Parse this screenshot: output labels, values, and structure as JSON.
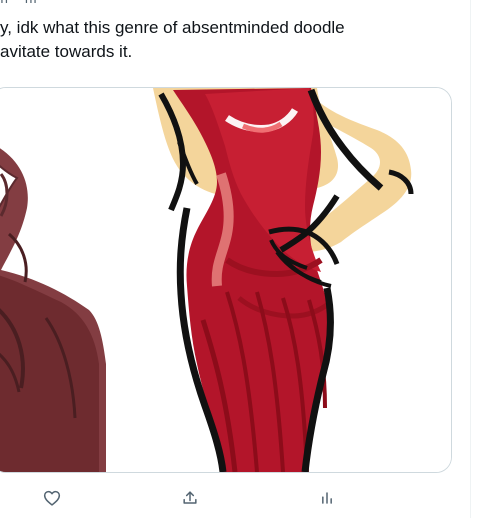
{
  "tweet": {
    "text": "y, idk what this genre of absentminded doodle\navitate towards it."
  },
  "media": {
    "image_alt": "Artwork"
  },
  "actions": {
    "like": "heart-icon",
    "share": "share-icon",
    "views": "views-icon"
  },
  "colors": {
    "text": "#0f1419",
    "muted": "#536471",
    "border": "#cfd9de",
    "dress": "#b3152a",
    "skin": "#f3d29a",
    "outline": "#111111"
  }
}
